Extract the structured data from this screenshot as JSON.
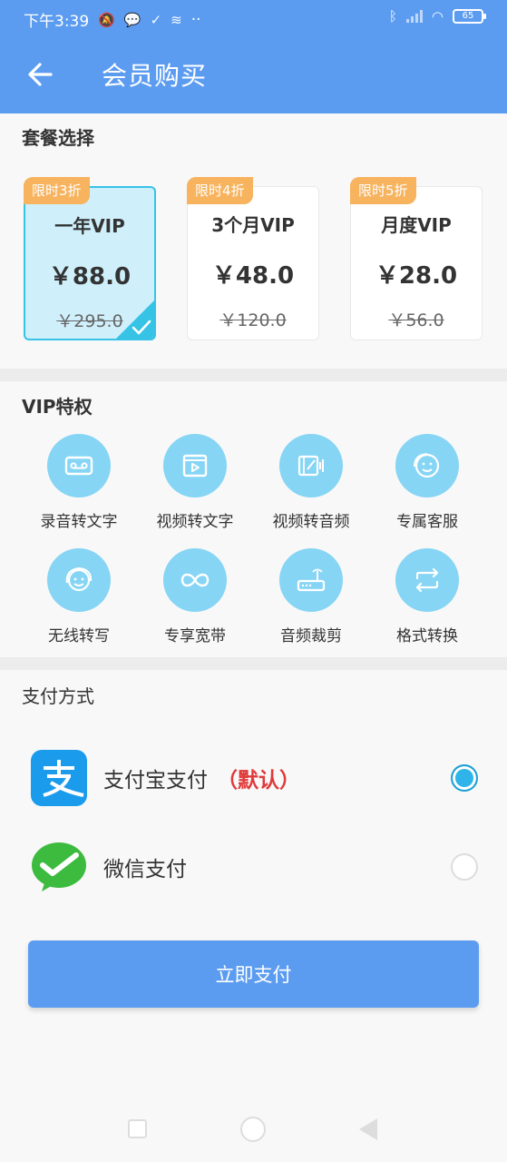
{
  "status": {
    "time": "下午3:39",
    "battery": "65",
    "dots": "··"
  },
  "header": {
    "title": "会员购买"
  },
  "plans_section": {
    "title": "套餐选择",
    "plans": [
      {
        "tag": "限时3折",
        "name": "一年VIP",
        "price": "￥88.0",
        "original": "￥295.0",
        "selected": true
      },
      {
        "tag": "限时4折",
        "name": "3个月VIP",
        "price": "￥48.0",
        "original": "￥120.0",
        "selected": false
      },
      {
        "tag": "限时5折",
        "name": "月度VIP",
        "price": "￥28.0",
        "original": "￥56.0",
        "selected": false
      }
    ]
  },
  "privileges": {
    "title": "VIP特权",
    "items": [
      {
        "label": "录音转文字",
        "icon": "cassette-icon"
      },
      {
        "label": "视频转文字",
        "icon": "video-icon"
      },
      {
        "label": "视频转音频",
        "icon": "film-audio-icon"
      },
      {
        "label": "专属客服",
        "icon": "service-face-icon"
      },
      {
        "label": "无线转写",
        "icon": "headset-face-icon"
      },
      {
        "label": "专享宽带",
        "icon": "infinity-icon"
      },
      {
        "label": "音频裁剪",
        "icon": "router-icon"
      },
      {
        "label": "格式转换",
        "icon": "swap-icon"
      }
    ]
  },
  "payment": {
    "title": "支付方式",
    "methods": [
      {
        "name": "支付宝支付",
        "default_label": "（默认）",
        "selected": true
      },
      {
        "name": "微信支付",
        "default_label": "",
        "selected": false
      }
    ],
    "submit_label": "立即支付"
  },
  "colors": {
    "primary": "#5c9cf0",
    "accent": "#36c3e6",
    "tag": "#f7b35e",
    "icon_bg": "#86d5f5",
    "alipay": "#1a9bec",
    "wechat": "#3dbb3f"
  }
}
